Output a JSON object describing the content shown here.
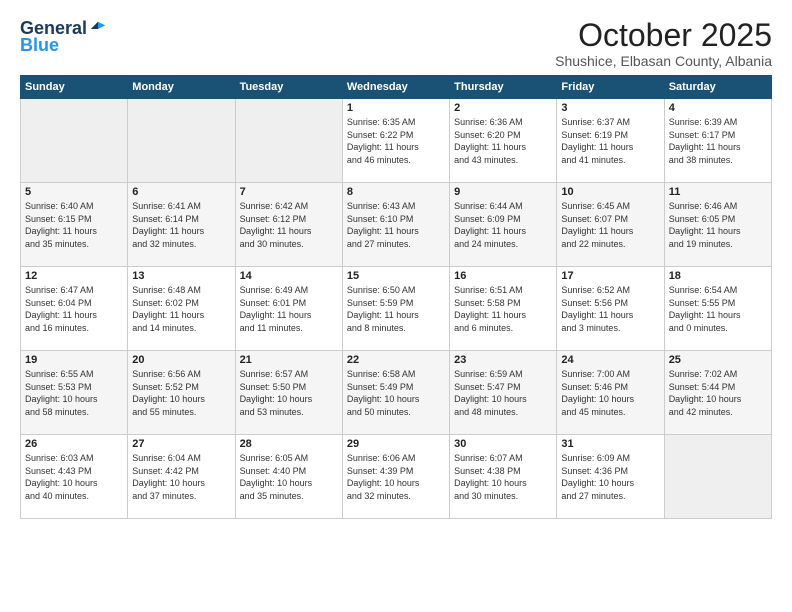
{
  "header": {
    "logo_general": "General",
    "logo_blue": "Blue",
    "month_title": "October 2025",
    "location": "Shushice, Elbasan County, Albania"
  },
  "days_of_week": [
    "Sunday",
    "Monday",
    "Tuesday",
    "Wednesday",
    "Thursday",
    "Friday",
    "Saturday"
  ],
  "weeks": [
    [
      {
        "day": "",
        "info": ""
      },
      {
        "day": "",
        "info": ""
      },
      {
        "day": "",
        "info": ""
      },
      {
        "day": "1",
        "info": "Sunrise: 6:35 AM\nSunset: 6:22 PM\nDaylight: 11 hours\nand 46 minutes."
      },
      {
        "day": "2",
        "info": "Sunrise: 6:36 AM\nSunset: 6:20 PM\nDaylight: 11 hours\nand 43 minutes."
      },
      {
        "day": "3",
        "info": "Sunrise: 6:37 AM\nSunset: 6:19 PM\nDaylight: 11 hours\nand 41 minutes."
      },
      {
        "day": "4",
        "info": "Sunrise: 6:39 AM\nSunset: 6:17 PM\nDaylight: 11 hours\nand 38 minutes."
      }
    ],
    [
      {
        "day": "5",
        "info": "Sunrise: 6:40 AM\nSunset: 6:15 PM\nDaylight: 11 hours\nand 35 minutes."
      },
      {
        "day": "6",
        "info": "Sunrise: 6:41 AM\nSunset: 6:14 PM\nDaylight: 11 hours\nand 32 minutes."
      },
      {
        "day": "7",
        "info": "Sunrise: 6:42 AM\nSunset: 6:12 PM\nDaylight: 11 hours\nand 30 minutes."
      },
      {
        "day": "8",
        "info": "Sunrise: 6:43 AM\nSunset: 6:10 PM\nDaylight: 11 hours\nand 27 minutes."
      },
      {
        "day": "9",
        "info": "Sunrise: 6:44 AM\nSunset: 6:09 PM\nDaylight: 11 hours\nand 24 minutes."
      },
      {
        "day": "10",
        "info": "Sunrise: 6:45 AM\nSunset: 6:07 PM\nDaylight: 11 hours\nand 22 minutes."
      },
      {
        "day": "11",
        "info": "Sunrise: 6:46 AM\nSunset: 6:05 PM\nDaylight: 11 hours\nand 19 minutes."
      }
    ],
    [
      {
        "day": "12",
        "info": "Sunrise: 6:47 AM\nSunset: 6:04 PM\nDaylight: 11 hours\nand 16 minutes."
      },
      {
        "day": "13",
        "info": "Sunrise: 6:48 AM\nSunset: 6:02 PM\nDaylight: 11 hours\nand 14 minutes."
      },
      {
        "day": "14",
        "info": "Sunrise: 6:49 AM\nSunset: 6:01 PM\nDaylight: 11 hours\nand 11 minutes."
      },
      {
        "day": "15",
        "info": "Sunrise: 6:50 AM\nSunset: 5:59 PM\nDaylight: 11 hours\nand 8 minutes."
      },
      {
        "day": "16",
        "info": "Sunrise: 6:51 AM\nSunset: 5:58 PM\nDaylight: 11 hours\nand 6 minutes."
      },
      {
        "day": "17",
        "info": "Sunrise: 6:52 AM\nSunset: 5:56 PM\nDaylight: 11 hours\nand 3 minutes."
      },
      {
        "day": "18",
        "info": "Sunrise: 6:54 AM\nSunset: 5:55 PM\nDaylight: 11 hours\nand 0 minutes."
      }
    ],
    [
      {
        "day": "19",
        "info": "Sunrise: 6:55 AM\nSunset: 5:53 PM\nDaylight: 10 hours\nand 58 minutes."
      },
      {
        "day": "20",
        "info": "Sunrise: 6:56 AM\nSunset: 5:52 PM\nDaylight: 10 hours\nand 55 minutes."
      },
      {
        "day": "21",
        "info": "Sunrise: 6:57 AM\nSunset: 5:50 PM\nDaylight: 10 hours\nand 53 minutes."
      },
      {
        "day": "22",
        "info": "Sunrise: 6:58 AM\nSunset: 5:49 PM\nDaylight: 10 hours\nand 50 minutes."
      },
      {
        "day": "23",
        "info": "Sunrise: 6:59 AM\nSunset: 5:47 PM\nDaylight: 10 hours\nand 48 minutes."
      },
      {
        "day": "24",
        "info": "Sunrise: 7:00 AM\nSunset: 5:46 PM\nDaylight: 10 hours\nand 45 minutes."
      },
      {
        "day": "25",
        "info": "Sunrise: 7:02 AM\nSunset: 5:44 PM\nDaylight: 10 hours\nand 42 minutes."
      }
    ],
    [
      {
        "day": "26",
        "info": "Sunrise: 6:03 AM\nSunset: 4:43 PM\nDaylight: 10 hours\nand 40 minutes."
      },
      {
        "day": "27",
        "info": "Sunrise: 6:04 AM\nSunset: 4:42 PM\nDaylight: 10 hours\nand 37 minutes."
      },
      {
        "day": "28",
        "info": "Sunrise: 6:05 AM\nSunset: 4:40 PM\nDaylight: 10 hours\nand 35 minutes."
      },
      {
        "day": "29",
        "info": "Sunrise: 6:06 AM\nSunset: 4:39 PM\nDaylight: 10 hours\nand 32 minutes."
      },
      {
        "day": "30",
        "info": "Sunrise: 6:07 AM\nSunset: 4:38 PM\nDaylight: 10 hours\nand 30 minutes."
      },
      {
        "day": "31",
        "info": "Sunrise: 6:09 AM\nSunset: 4:36 PM\nDaylight: 10 hours\nand 27 minutes."
      },
      {
        "day": "",
        "info": ""
      }
    ]
  ]
}
